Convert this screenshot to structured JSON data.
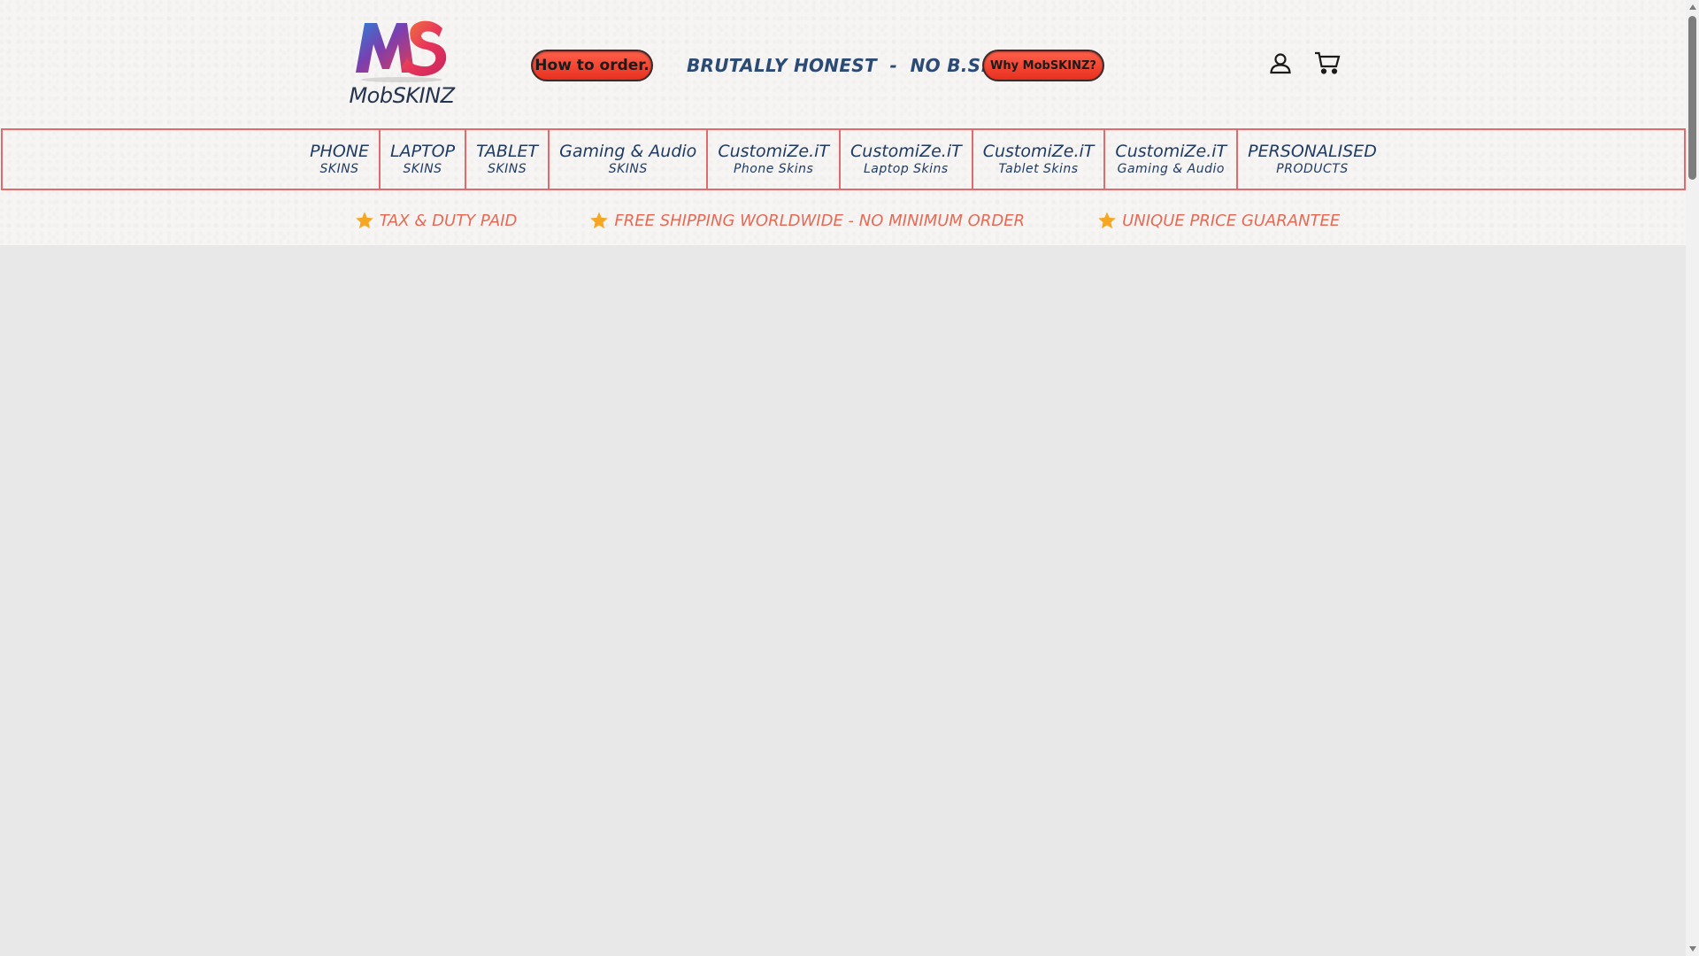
{
  "brand": {
    "name": "MobSKINZ"
  },
  "header": {
    "how_to_order": "How to order.",
    "tagline": "BRUTALLY HONEST  -  NO B.S.™",
    "why": "Why MobSKINZ?"
  },
  "icons": {
    "account": "account-icon",
    "cart": "cart-icon",
    "star": "star-icon"
  },
  "nav": [
    {
      "main": "PHONE",
      "sub": "SKINS"
    },
    {
      "main": "LAPTOP",
      "sub": "SKINS"
    },
    {
      "main": "TABLET",
      "sub": "SKINS"
    },
    {
      "main": "Gaming & Audio",
      "sub": "SKINS"
    },
    {
      "main": "CustomiZe.iT",
      "sub": "Phone Skins"
    },
    {
      "main": "CustomiZe.iT",
      "sub": "Laptop Skins"
    },
    {
      "main": "CustomiZe.iT",
      "sub": "Tablet Skins"
    },
    {
      "main": "CustomiZe.iT",
      "sub": "Gaming & Audio"
    },
    {
      "main": "PERSONALISED",
      "sub": "PRODUCTS"
    }
  ],
  "benefits": [
    "TAX & DUTY PAID",
    "FREE SHIPPING WORLDWIDE - NO MINIMUM ORDER",
    "UNIQUE PRICE GUARANTEE"
  ],
  "colors": {
    "accent": "#e8311f",
    "nav_text": "#1f3b63",
    "benefit_text": "#e56a55",
    "star": "#f5a623"
  }
}
